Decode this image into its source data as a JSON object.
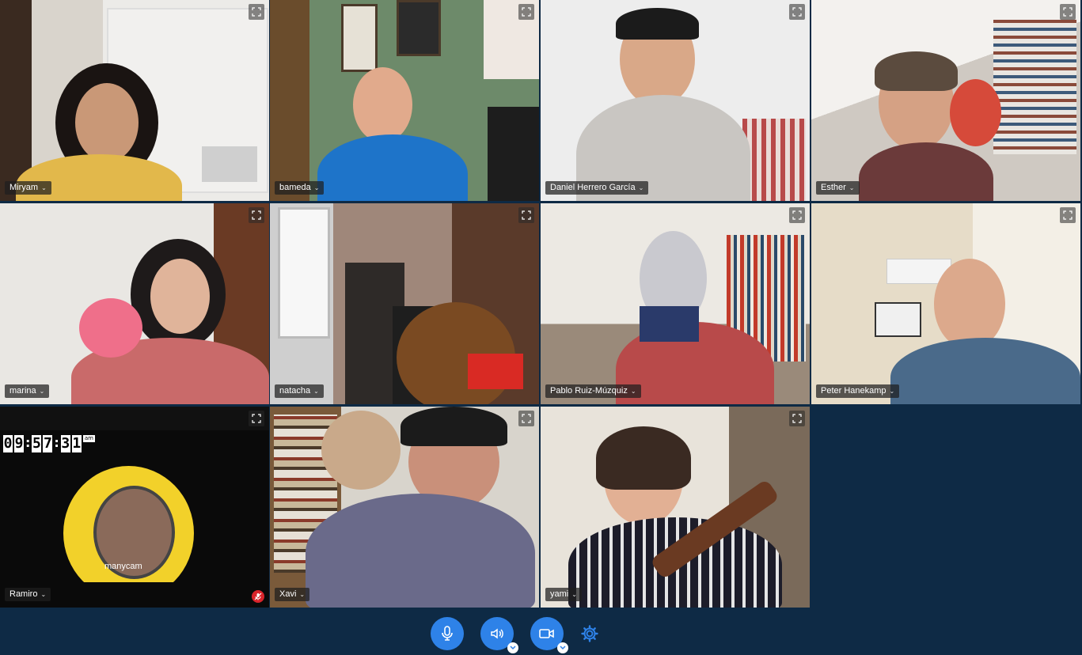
{
  "participants": [
    {
      "name": "Miryam"
    },
    {
      "name": "bameda"
    },
    {
      "name": "Daniel Herrero García"
    },
    {
      "name": "Esther"
    },
    {
      "name": "marina"
    },
    {
      "name": "natacha"
    },
    {
      "name": "Pablo Ruiz-Múzquiz"
    },
    {
      "name": "Peter Hanekamp"
    },
    {
      "name": "Ramiro"
    },
    {
      "name": "Xavi"
    },
    {
      "name": "yami"
    }
  ],
  "ramiro_overlay": {
    "clock": [
      "0",
      "9",
      ":",
      "5",
      "7",
      ":",
      "3",
      "1"
    ],
    "ampm": "am",
    "watermark": "manycam"
  },
  "colors": {
    "background": "#0e2a45",
    "control_blue": "#2e82e8",
    "active_speaker": "#2d8cff",
    "muted_red": "#d9242b"
  },
  "controls": {
    "icons": [
      "microphone-icon",
      "speaker-icon",
      "camera-icon",
      "gear-icon"
    ]
  }
}
